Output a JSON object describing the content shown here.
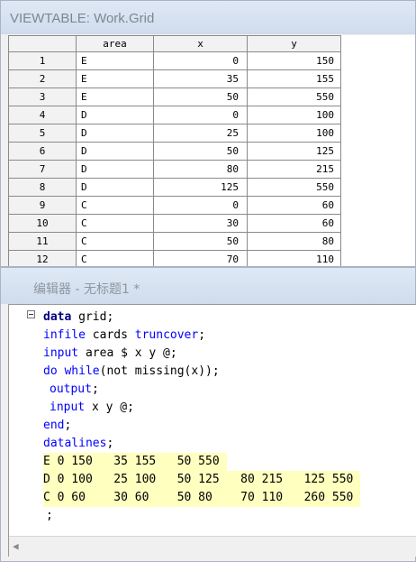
{
  "viewtable": {
    "title": "VIEWTABLE: Work.Grid",
    "columns": [
      "",
      "area",
      "x",
      "y"
    ],
    "rows": [
      {
        "n": "1",
        "area": "E",
        "x": "0",
        "y": "150"
      },
      {
        "n": "2",
        "area": "E",
        "x": "35",
        "y": "155"
      },
      {
        "n": "3",
        "area": "E",
        "x": "50",
        "y": "550"
      },
      {
        "n": "4",
        "area": "D",
        "x": "0",
        "y": "100"
      },
      {
        "n": "5",
        "area": "D",
        "x": "25",
        "y": "100"
      },
      {
        "n": "6",
        "area": "D",
        "x": "50",
        "y": "125"
      },
      {
        "n": "7",
        "area": "D",
        "x": "80",
        "y": "215"
      },
      {
        "n": "8",
        "area": "D",
        "x": "125",
        "y": "550"
      },
      {
        "n": "9",
        "area": "C",
        "x": "0",
        "y": "60"
      },
      {
        "n": "10",
        "area": "C",
        "x": "30",
        "y": "60"
      },
      {
        "n": "11",
        "area": "C",
        "x": "50",
        "y": "80"
      },
      {
        "n": "12",
        "area": "C",
        "x": "70",
        "y": "110"
      }
    ]
  },
  "editor": {
    "title": "编辑器 - 无标题1 *",
    "code": {
      "l1_kw": "data",
      "l1_rest": " grid;",
      "l2_a": "infile",
      "l2_b": " cards ",
      "l2_c": "truncover",
      "l2_d": ";",
      "l3_a": "input",
      "l3_b": " area $ x y @;",
      "l4_a": "do while",
      "l4_b": "(not missing(x));",
      "l5_a": "output",
      "l5_b": ";",
      "l6_a": "input",
      "l6_b": " x y @;",
      "l7_a": "end",
      "l7_b": ";",
      "l8_a": "datalines",
      "l8_b": ";",
      "data1": "E 0 150   35 155   50 550",
      "data2": "D 0 100   25 100   50 125   80 215   125 550",
      "data3": "C 0 60    30 60    50 80    70 110   260 550",
      "end": ";"
    }
  },
  "colors": {
    "keyword": "#000080",
    "statement": "#0000ff",
    "datalines_highlight": "#ffffc0"
  }
}
